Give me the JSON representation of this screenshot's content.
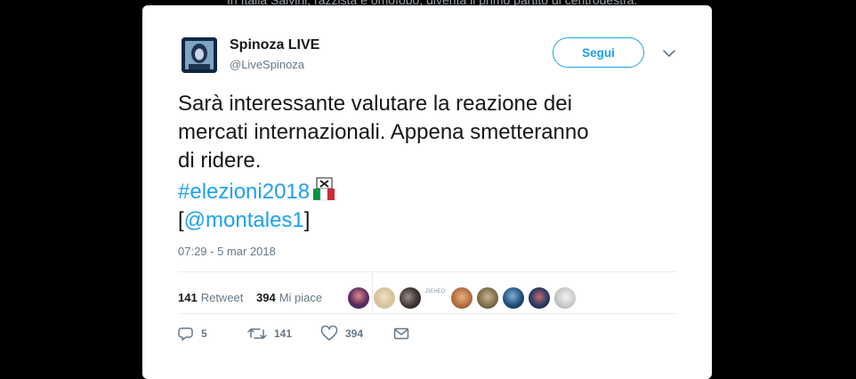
{
  "background": {
    "headline_fragment": "In Italia Salvini, razzista e omofobo, diventa il primo partito di centrodestra."
  },
  "tweet": {
    "author": {
      "name": "Spinoza LIVE",
      "handle": "@LiveSpinoza"
    },
    "follow_label": "Segui",
    "text_lines": [
      "Sarà interessante valutare la reazione dei",
      "mercati internazionali. Appena smetteranno",
      "di ridere."
    ],
    "hashtag": "#elezioni2018",
    "mention_open": "[",
    "mention": "@montales1",
    "mention_close": "]",
    "timestamp": "07:29 - 5 mar 2018",
    "stats": {
      "retweets_count": "141",
      "retweets_label": "Retweet",
      "likes_count": "394",
      "likes_label": "Mi piace"
    },
    "liker_tiny_label": "ZIEHEO",
    "actions": {
      "replies": "5",
      "retweets": "141",
      "likes": "394"
    }
  },
  "colors": {
    "accent": "#1da1f2",
    "text": "#14171a",
    "muted": "#657786",
    "divider": "#e6ecf0"
  },
  "icons": [
    "avatar-portrait",
    "chevron-down-icon",
    "ballot-box-icon",
    "italy-flag-icon",
    "reply-icon",
    "retweet-icon",
    "heart-icon",
    "envelope-icon"
  ]
}
